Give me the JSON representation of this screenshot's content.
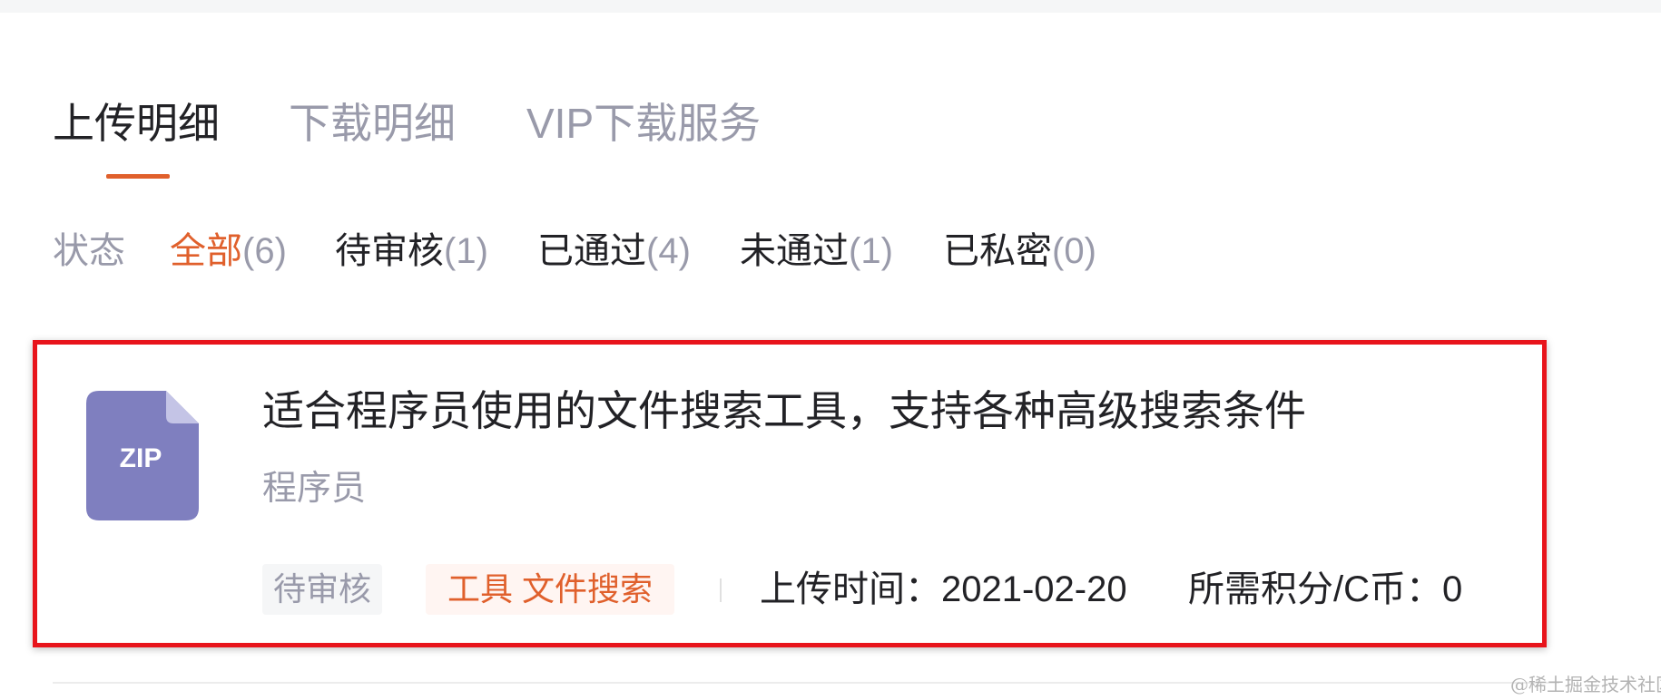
{
  "tabs": [
    {
      "label": "上传明细",
      "active": true
    },
    {
      "label": "下载明细",
      "active": false
    },
    {
      "label": "VIP下载服务",
      "active": false
    }
  ],
  "filter": {
    "label": "状态",
    "items": [
      {
        "name": "全部",
        "count": "(6)",
        "active": true
      },
      {
        "name": "待审核",
        "count": "(1)",
        "active": false
      },
      {
        "name": "已通过",
        "count": "(4)",
        "active": false
      },
      {
        "name": "未通过",
        "count": "(1)",
        "active": false
      },
      {
        "name": "已私密",
        "count": "(0)",
        "active": false
      }
    ]
  },
  "resource": {
    "icon_label": "ZIP",
    "icon": "zip-file-icon",
    "title": "适合程序员使用的文件搜索工具，支持各种高级搜索条件",
    "category": "程序员",
    "status": "待审核",
    "tags": "工具 文件搜索",
    "upload_time": "上传时间：2021-02-20",
    "points": "所需积分/C币：0"
  },
  "watermark": "@稀土掘金技术社区",
  "colors": {
    "accent": "#e0602c",
    "highlight_border": "#e8141b",
    "zip_icon": "#7f7fbf",
    "muted_text": "#999aaa",
    "primary_text": "#222226"
  }
}
